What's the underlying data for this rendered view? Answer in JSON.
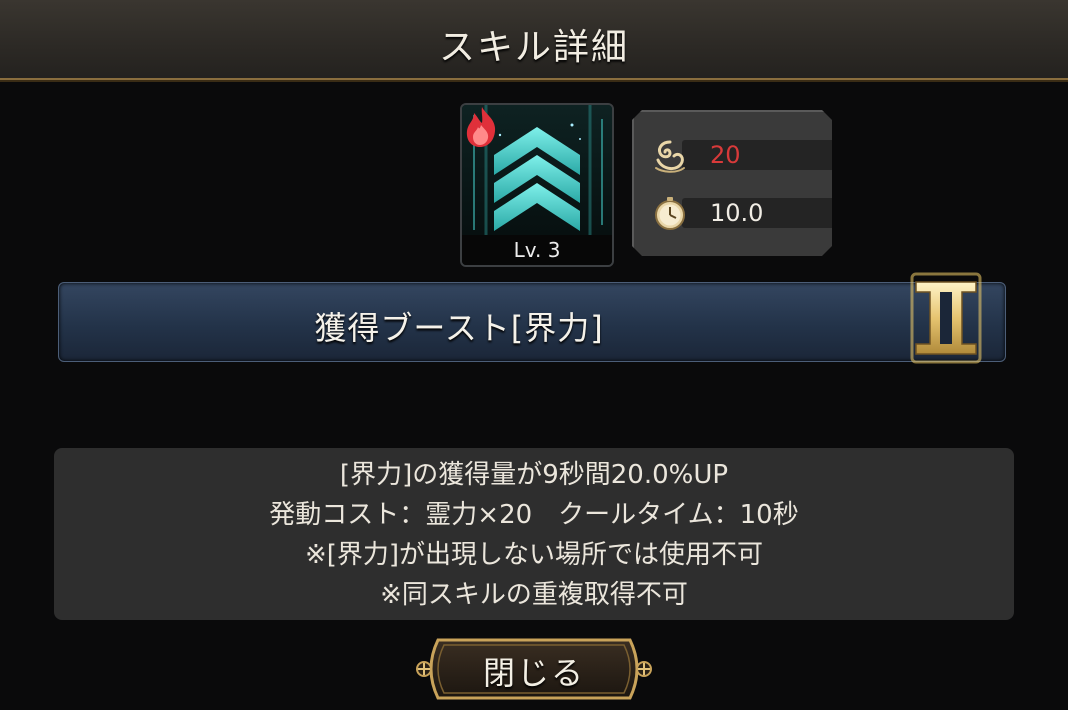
{
  "header": {
    "title": "スキル詳細"
  },
  "skill": {
    "level_label": "Lv. 3",
    "icon": "teal-chevron-boost-icon",
    "element_icon": "fire-element-icon",
    "name": "獲得ブースト[界力]",
    "rank_icon": "roman-numeral-two-icon"
  },
  "stats": {
    "cost_icon": "spirit-cost-icon",
    "cost_value": "20",
    "cost_color": "#d83a3a",
    "cooldown_icon": "stopwatch-icon",
    "cooldown_value": "10.0"
  },
  "description": {
    "lines": [
      "[界力]の獲得量が9秒間20.0%UP",
      "発動コスト：霊力×20　クールタイム：10秒",
      "※[界力]が出現しない場所では使用不可",
      "※同スキルの重複取得不可"
    ]
  },
  "close_button": {
    "label": "閉じる"
  },
  "colors": {
    "accent_gold": "#c9a35a",
    "name_bar": "#233349",
    "teal_icon": "#4fd3cf"
  }
}
